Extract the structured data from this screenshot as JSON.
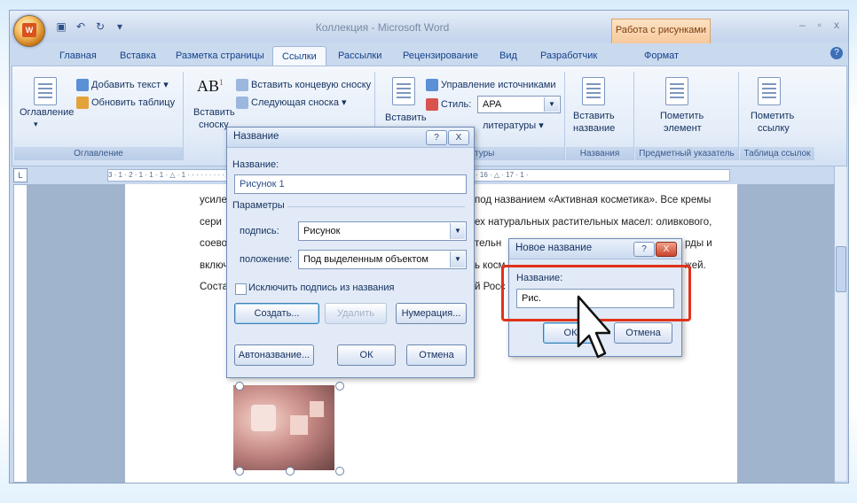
{
  "window": {
    "title": "Коллекция - Microsoft Word",
    "contextual_tab_group": "Работа с рисунками",
    "controls": [
      "–",
      "▫",
      "x"
    ]
  },
  "tabs": [
    {
      "label": "Главная"
    },
    {
      "label": "Вставка"
    },
    {
      "label": "Разметка страницы"
    },
    {
      "label": "Ссылки",
      "active": true
    },
    {
      "label": "Рассылки"
    },
    {
      "label": "Рецензирование"
    },
    {
      "label": "Вид"
    },
    {
      "label": "Разработчик"
    },
    {
      "label": "Формат"
    }
  ],
  "ribbon": {
    "toc_group": {
      "label": "Оглавление",
      "big_button": "Оглавление",
      "add_text": "Добавить текст",
      "update_table": "Обновить таблицу"
    },
    "footnotes_group": {
      "insert_footnote_line1": "Вставить",
      "insert_footnote_line2": "сноску",
      "insert_endnote": "Вставить концевую сноску",
      "next_footnote": "Следующая сноска"
    },
    "citations_group": {
      "insert_line1": "Вставить",
      "manage_sources": "Управление источниками",
      "style_label": "Стиль:",
      "style_value": "APA",
      "bibliography": "литературы",
      "group_label": "литературы"
    },
    "captions_group": {
      "label": "Названия",
      "insert_caption_line1": "Вставить",
      "insert_caption_line2": "название"
    },
    "index_group": {
      "label": "Предметный указатель",
      "mark_entry_line1": "Пометить",
      "mark_entry_line2": "элемент"
    },
    "toa_group": {
      "label": "Таблица ссылок",
      "mark_citation_line1": "Пометить",
      "mark_citation_line2": "ссылку"
    },
    "accent_color": "#f6c99c"
  },
  "ruler": {
    "text": "3 · 1 · 2 · 1 · 1 · 1 · △ · 1 · · · · · · · · · · · · · · · · · · · · · · · · · · · · · 9 · 1 · 10 · 1 · 11 · 1 · 12 · 1 · 13 · 1 · 14 · 1 · 15 · 1 · 16 · △ · 17 · 1 ·"
  },
  "document": {
    "lines": [
      {
        "left": "усиле",
        "right": "под названием «Активная косметика». Все кремы"
      },
      {
        "left": "сери",
        "right": "ех натуральных растительных масел: оливкового,"
      },
      {
        "left": "соево",
        "right": "тельн",
        "tail": "рды и"
      },
      {
        "left": "включ",
        "right": "ь косм",
        "tail": "жей."
      },
      {
        "left": "Соста",
        "right": "й Росс"
      }
    ]
  },
  "caption_dialog": {
    "title": "Название",
    "help": "?",
    "close": "X",
    "caption_label": "Название:",
    "caption_value": "Рисунок 1",
    "options_label": "Параметры",
    "label_label": "подпись:",
    "label_value": "Рисунок",
    "position_label": "положение:",
    "position_value": "Под выделенным объектом",
    "exclude_label": "Исключить подпись из названия",
    "new_label_button": "Создать...",
    "delete_label_button": "Удалить",
    "numbering_button": "Нумерация...",
    "autocaption_button": "Автоназвание...",
    "ok_button": "ОК",
    "cancel_button": "Отмена"
  },
  "new_label_dialog": {
    "title": "Новое название",
    "help": "?",
    "close": "X",
    "label_label": "Название:",
    "label_value": "Рис.",
    "ok_button": "ОК",
    "cancel_button": "Отмена",
    "highlight_color": "#e0331b"
  }
}
